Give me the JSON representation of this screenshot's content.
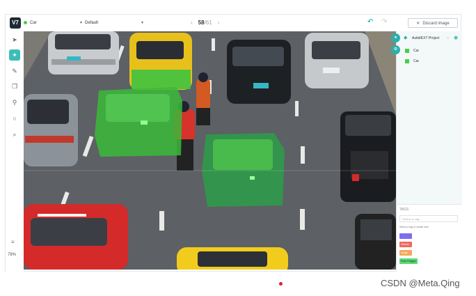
{
  "app": {
    "logo": "V7"
  },
  "topbar": {
    "class_select": "Car",
    "preset_select": "Default",
    "page_current": "58",
    "page_total": "/61",
    "discard_label": "Discard image",
    "prev_icon": "chevron-left-icon",
    "next_icon": "chevron-right-icon",
    "undo_icon": "undo-icon",
    "redo_icon": "redo-icon"
  },
  "toolbar": {
    "tools": [
      "pointer-icon",
      "auto-annotate-icon",
      "brush-icon",
      "copy-icon",
      "keypoint-icon",
      "ellipse-icon",
      "search-icon"
    ],
    "zoom": "78%"
  },
  "panel": {
    "head_text": "Autid/EXT Project",
    "annotations": [
      {
        "label": "Car"
      },
      {
        "label": "Car"
      }
    ],
    "tags": {
      "title": "TAGS",
      "input_placeholder": "Search or tag...",
      "hint": "Select a tag or create new",
      "chips": [
        "",
        "Vehicle",
        "Image",
        "Point Polygon"
      ]
    }
  },
  "colors": {
    "accent": "#2bb0aa",
    "annotation": "#43d046"
  },
  "watermark": "CSDN @Meta.Qing"
}
